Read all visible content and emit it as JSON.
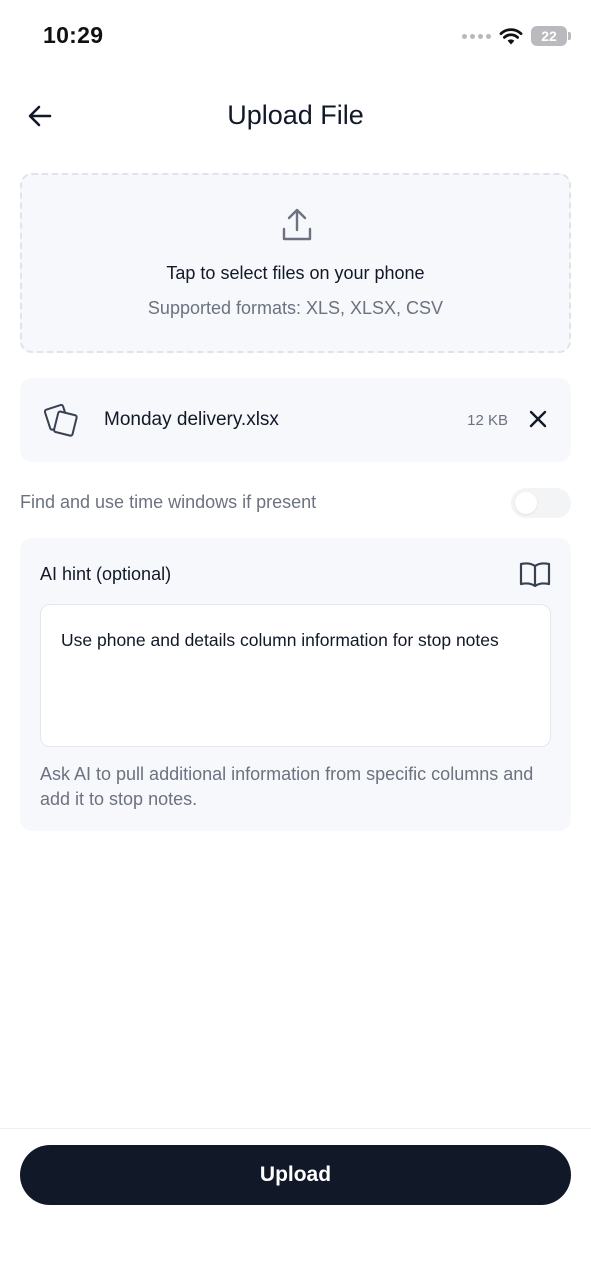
{
  "status_bar": {
    "time": "10:29",
    "battery": "22"
  },
  "header": {
    "title": "Upload File",
    "back_icon": "arrow-left-icon"
  },
  "dropzone": {
    "icon": "upload-icon",
    "title": "Tap to select files on your phone",
    "subtitle": "Supported formats: XLS, XLSX, CSV"
  },
  "file": {
    "name": "Monday delivery.xlsx",
    "size": "12 KB",
    "icon": "file-stack-icon",
    "remove_icon": "close-icon"
  },
  "time_windows": {
    "label": "Find and use time windows if present",
    "enabled": false
  },
  "ai_hint": {
    "title": "AI hint (optional)",
    "icon": "book-open-icon",
    "value": "Use phone and details column information for stop notes",
    "help": "Ask AI to pull additional information from specific columns and add it to stop notes."
  },
  "actions": {
    "upload_label": "Upload"
  },
  "colors": {
    "primary": "#111827",
    "muted": "#6b7280",
    "surface": "#f7f8fb",
    "border": "#dfe3ea"
  }
}
